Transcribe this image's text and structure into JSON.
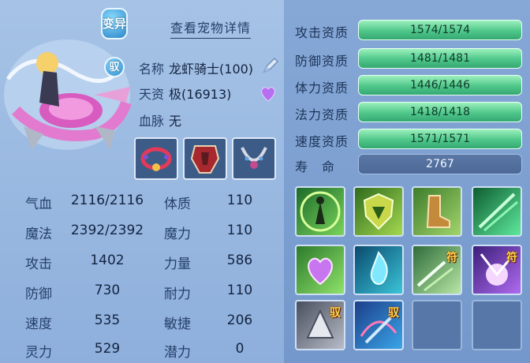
{
  "badges": {
    "top": "变异",
    "bottom": "驭"
  },
  "detail_link": "查看宠物详情",
  "info": {
    "name_label": "名称",
    "name_value": "龙虾骑士(100)",
    "talent_label": "天资",
    "talent_value": "极(16913)",
    "blood_label": "血脉",
    "blood_value": "无"
  },
  "stats": [
    {
      "label": "气血",
      "value": "2116/2116",
      "label2": "体质",
      "value2": "110"
    },
    {
      "label": "魔法",
      "value": "2392/2392",
      "label2": "魔力",
      "value2": "110"
    },
    {
      "label": "攻击",
      "value": "1402",
      "label2": "力量",
      "value2": "586"
    },
    {
      "label": "防御",
      "value": "730",
      "label2": "耐力",
      "value2": "110"
    },
    {
      "label": "速度",
      "value": "535",
      "label2": "敏捷",
      "value2": "206"
    },
    {
      "label": "灵力",
      "value": "529",
      "label2": "潜力",
      "value2": "0"
    }
  ],
  "aptitudes": [
    {
      "label": "攻击资质",
      "value": "1574/1574"
    },
    {
      "label": "防御资质",
      "value": "1481/1481"
    },
    {
      "label": "体力资质",
      "value": "1446/1446"
    },
    {
      "label": "法力资质",
      "value": "1418/1418"
    },
    {
      "label": "速度资质",
      "value": "1571/1571"
    }
  ],
  "life": {
    "label": "寿　命",
    "value": "2767"
  },
  "skill_tags": {
    "fu1": "符",
    "fu2": "符",
    "yu1": "驭",
    "yu2": "驭"
  }
}
